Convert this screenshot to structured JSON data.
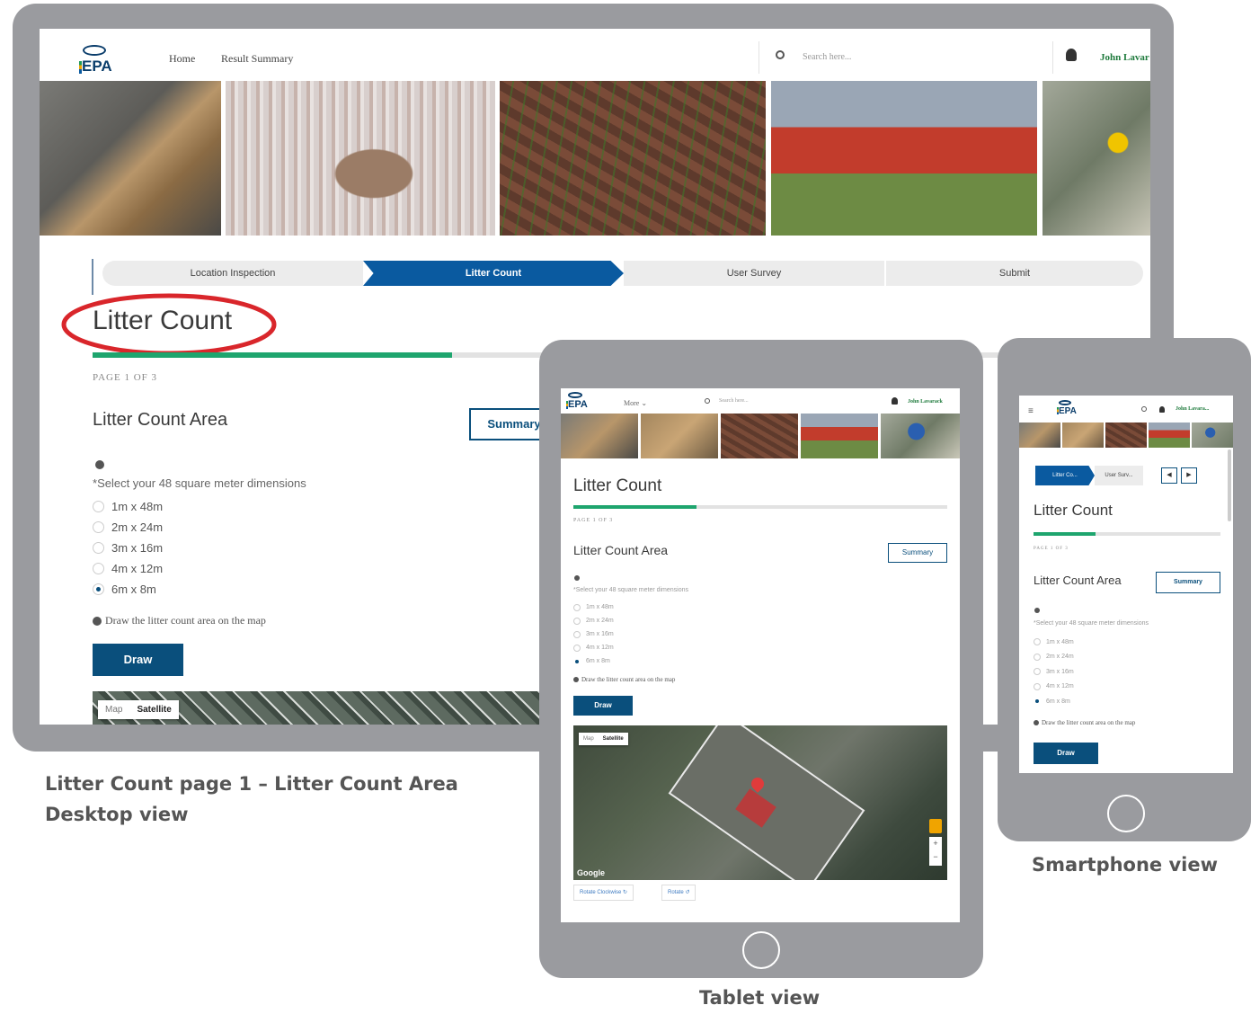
{
  "app": {
    "logo_text": "EPA",
    "user_name_full": "John Lavar",
    "user_name_tablet": "John Lavarack",
    "user_name_phone": "John Lavara...",
    "search_placeholder": "Search here...",
    "nav_desktop": [
      "Home",
      "Result Summary"
    ],
    "nav_tablet_more": "More"
  },
  "stepper": {
    "steps": [
      "Location Inspection",
      "Litter Count",
      "User Survey",
      "Submit"
    ],
    "active_index": 1,
    "phone_steps": [
      "Litter Co...",
      "User Surv..."
    ]
  },
  "page": {
    "title": "Litter Count",
    "page_label": "PAGE 1 OF 3",
    "progress_fraction": 0.33,
    "section_title": "Litter Count Area",
    "summary_label": "Summary",
    "required_label": "Select your 48 square meter dimensions",
    "dimensions": [
      "1m x 48m",
      "2m x 24m",
      "3m x 16m",
      "4m x 12m",
      "6m x 8m"
    ],
    "selected_dimension": "6m x 8m",
    "draw_hint": "Draw the litter count area on the map",
    "draw_label": "Draw"
  },
  "map": {
    "map_tab": "Map",
    "satellite_tab": "Satellite",
    "rotate_cw_label": "Rotate Clockwise",
    "rotate_label": "Rotate",
    "google_label": "Google"
  },
  "captions": {
    "desktop_line1": "Litter Count page 1 – Litter Count Area",
    "desktop_line2": "Desktop view",
    "tablet": "Tablet view",
    "smartphone": "Smartphone view"
  },
  "colors": {
    "frame": "#9a9b9f",
    "brand_blue": "#0a4f7c",
    "active_step": "#0a5aa0",
    "progress": "#1ea56e",
    "annotation_red": "#d9262b"
  }
}
